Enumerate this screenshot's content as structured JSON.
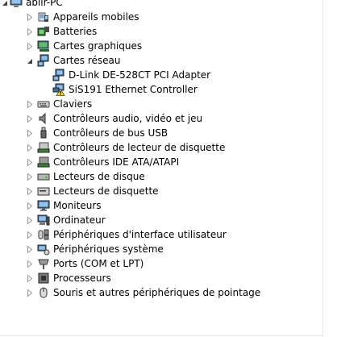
{
  "tree": {
    "root": {
      "label": "abiir-PC",
      "icon": "computer-icon"
    },
    "items": [
      {
        "label": "Appareils mobiles",
        "icon": "mobile-device-icon"
      },
      {
        "label": "Batteries",
        "icon": "battery-icon"
      },
      {
        "label": "Cartes graphiques",
        "icon": "display-adapter-icon"
      },
      {
        "label": "Cartes réseau",
        "icon": "network-adapter-icon",
        "expanded": true,
        "children": [
          {
            "label": "D-Link DE-528CT PCI Adapter",
            "icon": "network-adapter-icon"
          },
          {
            "label": "SiS191 Ethernet Controller",
            "icon": "network-adapter-warning-icon"
          }
        ]
      },
      {
        "label": "Claviers",
        "icon": "keyboard-icon"
      },
      {
        "label": "Contrôleurs audio, vidéo et jeu",
        "icon": "speaker-icon"
      },
      {
        "label": "Contrôleurs de bus USB",
        "icon": "usb-icon"
      },
      {
        "label": "Contrôleurs de lecteur de disquette",
        "icon": "floppy-controller-icon"
      },
      {
        "label": "Contrôleurs IDE ATA/ATAPI",
        "icon": "ide-controller-icon"
      },
      {
        "label": "Lecteurs de disque",
        "icon": "disk-drive-icon"
      },
      {
        "label": "Lecteurs de disquette",
        "icon": "floppy-drive-icon"
      },
      {
        "label": "Moniteurs",
        "icon": "monitor-icon"
      },
      {
        "label": "Ordinateur",
        "icon": "computer-icon"
      },
      {
        "label": "Périphériques d'interface utilisateur",
        "icon": "hid-icon"
      },
      {
        "label": "Périphériques système",
        "icon": "system-device-icon"
      },
      {
        "label": "Ports (COM et LPT)",
        "icon": "port-icon"
      },
      {
        "label": "Processeurs",
        "icon": "processor-icon"
      },
      {
        "label": "Souris et autres périphériques de pointage",
        "icon": "mouse-icon"
      }
    ]
  }
}
